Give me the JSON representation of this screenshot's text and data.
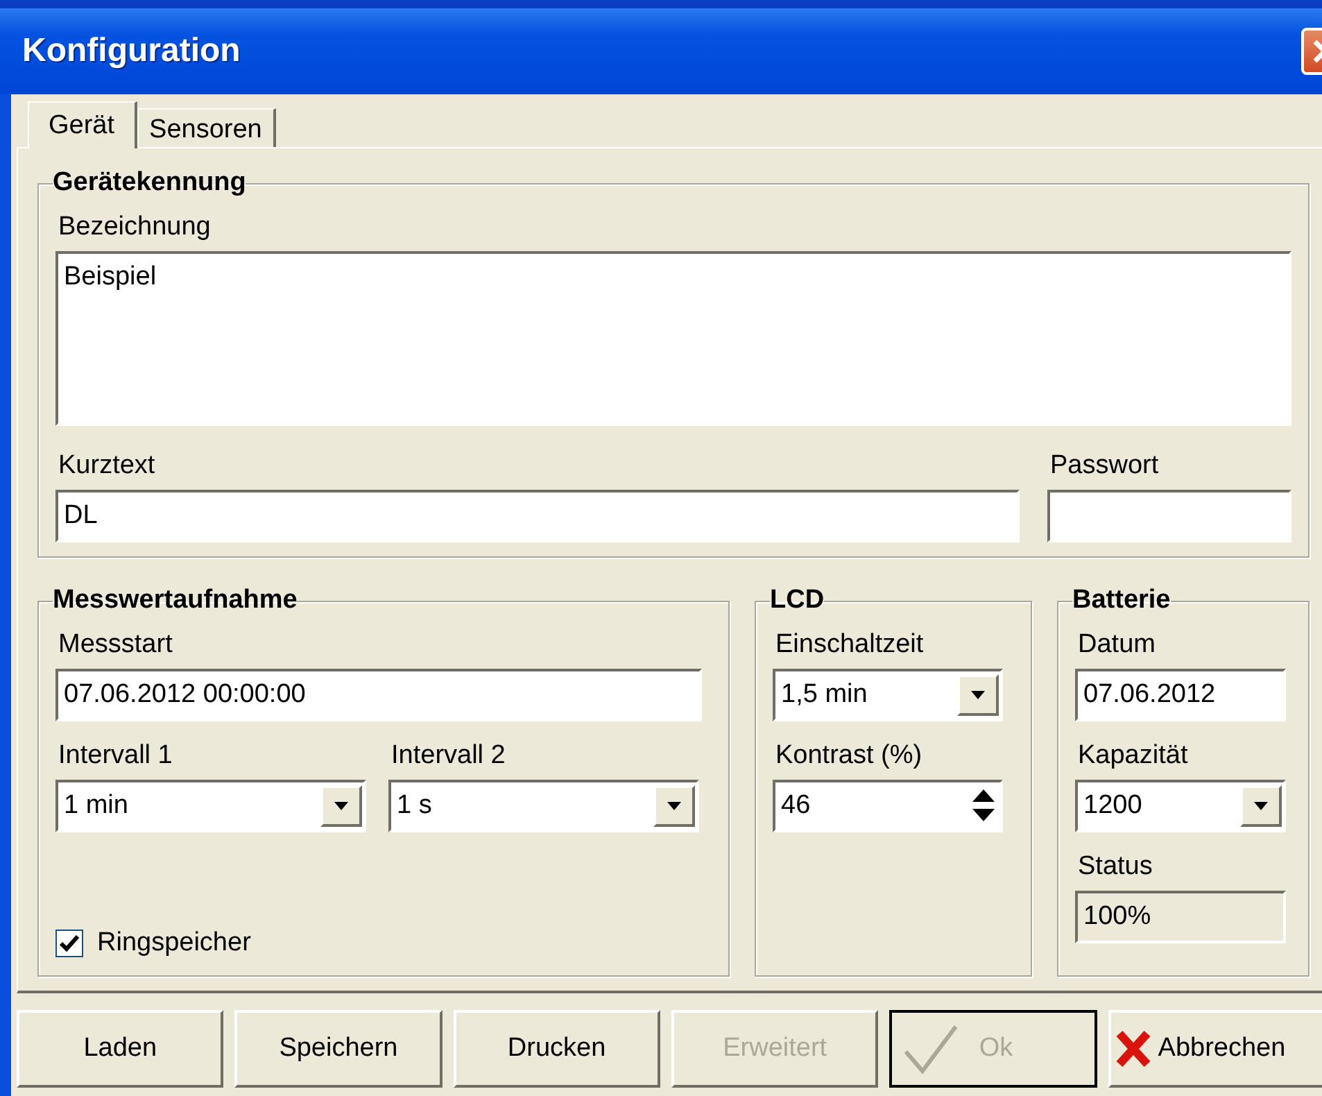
{
  "window": {
    "title": "Konfiguration"
  },
  "tabs": [
    {
      "label": "Gerät",
      "selected": true
    },
    {
      "label": "Sensoren",
      "selected": false
    }
  ],
  "geraetekennung": {
    "title": "Gerätekennung",
    "bezeichnung_label": "Bezeichnung",
    "bezeichnung_value": "Beispiel",
    "kurztext_label": "Kurztext",
    "kurztext_value": "DL",
    "passwort_label": "Passwort"
  },
  "messwertaufnahme": {
    "title": "Messwertaufnahme",
    "messstart_label": "Messstart",
    "messstart_value": "07.06.2012 00:00:00",
    "intervall1_label": "Intervall 1",
    "intervall1_value": "1 min",
    "intervall2_label": "Intervall 2",
    "intervall2_value": "1 s",
    "ringspeicher": {
      "label": "Ringspeicher",
      "checked": true
    }
  },
  "lcd": {
    "title": "LCD",
    "einschaltzeit_label": "Einschaltzeit",
    "einschaltzeit_value": "1,5 min",
    "kontrast_label": "Kontrast (%)",
    "kontrast_value": "46"
  },
  "batterie": {
    "title": "Batterie",
    "datum_label": "Datum",
    "datum_value": "07.06.2012",
    "kapazitaet_label": "Kapazität",
    "kapazitaet_value": "1200",
    "status_label": "Status",
    "status_value": "100%"
  },
  "buttons": [
    {
      "label": "Laden",
      "disabled": false
    },
    {
      "label": "Speichern",
      "disabled": false
    },
    {
      "label": "Drucken",
      "disabled": false
    },
    {
      "label": "Erweitert",
      "disabled": true
    },
    {
      "label": "Ok",
      "disabled": true,
      "kind": "check",
      "focused": true
    },
    {
      "label": "Abbrechen",
      "disabled": false,
      "kind": "cross"
    }
  ]
}
